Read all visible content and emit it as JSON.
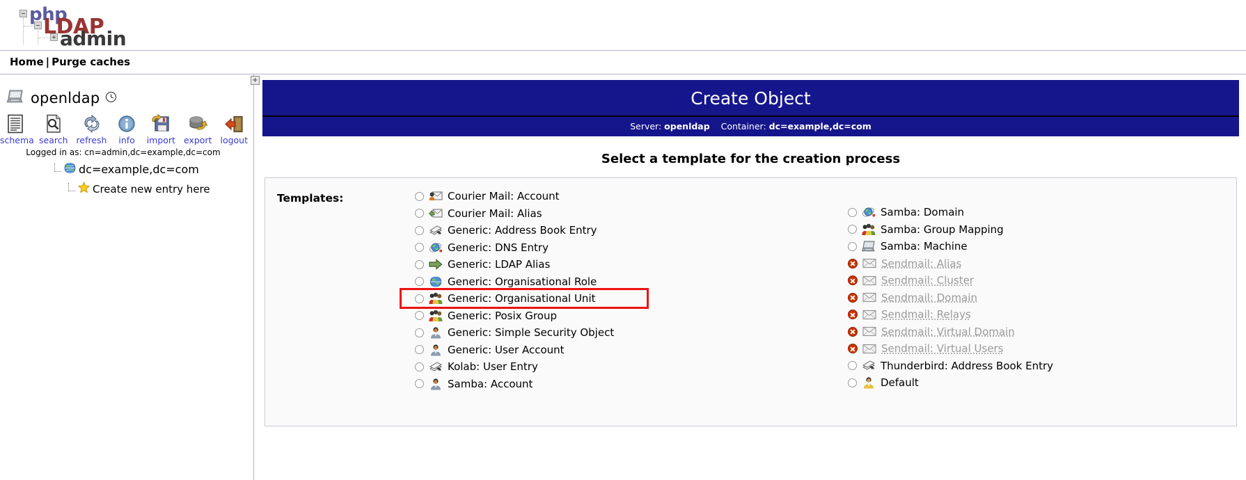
{
  "logo": {
    "part1": "php",
    "part2": "LDAP",
    "part3": "admin"
  },
  "navbar": {
    "home": "Home",
    "separator": "|",
    "purge": "Purge caches"
  },
  "sidebar": {
    "server_name": "openldap",
    "tools": [
      {
        "label": "schema",
        "icon": "schema-icon"
      },
      {
        "label": "search",
        "icon": "search-icon"
      },
      {
        "label": "refresh",
        "icon": "refresh-icon"
      },
      {
        "label": "info",
        "icon": "info-icon"
      },
      {
        "label": "import",
        "icon": "import-icon"
      },
      {
        "label": "export",
        "icon": "export-icon"
      },
      {
        "label": "logout",
        "icon": "logout-icon"
      }
    ],
    "logged_in_as": "Logged in as: cn=admin,dc=example,dc=com",
    "tree": [
      {
        "label": "dc=example,dc=com",
        "icon": "globe-icon"
      },
      {
        "label": "Create new entry here",
        "icon": "star-icon"
      }
    ],
    "expand_button": "+"
  },
  "header": {
    "title": "Create Object",
    "server_label": "Server:",
    "server_value": "openldap",
    "container_label": "Container:",
    "container_value": "dc=example,dc=com"
  },
  "main": {
    "section_title": "Select a template for the creation process",
    "templates_label": "Templates:",
    "left_column": [
      {
        "label": "Courier Mail: Account",
        "icon": "mail-user-icon",
        "disabled": false,
        "highlighted": false
      },
      {
        "label": "Courier Mail: Alias",
        "icon": "mail-arrow-icon",
        "disabled": false,
        "highlighted": false
      },
      {
        "label": "Generic: Address Book Entry",
        "icon": "address-book-icon",
        "disabled": false,
        "highlighted": false
      },
      {
        "label": "Generic: DNS Entry",
        "icon": "dns-globe-icon",
        "disabled": false,
        "highlighted": false
      },
      {
        "label": "Generic: LDAP Alias",
        "icon": "arrow-right-icon",
        "disabled": false,
        "highlighted": false
      },
      {
        "label": "Generic: Organisational Role",
        "icon": "globe-icon",
        "disabled": false,
        "highlighted": false
      },
      {
        "label": "Generic: Organisational Unit",
        "icon": "group-icon",
        "disabled": false,
        "highlighted": true
      },
      {
        "label": "Generic: Posix Group",
        "icon": "group-icon",
        "disabled": false,
        "highlighted": false
      },
      {
        "label": "Generic: Simple Security Object",
        "icon": "user-icon",
        "disabled": false,
        "highlighted": false
      },
      {
        "label": "Generic: User Account",
        "icon": "user-icon",
        "disabled": false,
        "highlighted": false
      },
      {
        "label": "Kolab: User Entry",
        "icon": "address-book-icon",
        "disabled": false,
        "highlighted": false
      },
      {
        "label": "Samba: Account",
        "icon": "user-icon",
        "disabled": false,
        "highlighted": false
      }
    ],
    "right_column": [
      {
        "label": "Samba: Domain",
        "icon": "dns-globe-icon",
        "disabled": false
      },
      {
        "label": "Samba: Group Mapping",
        "icon": "group-icon",
        "disabled": false
      },
      {
        "label": "Samba: Machine",
        "icon": "computer-icon",
        "disabled": false
      },
      {
        "label": "Sendmail: Alias",
        "icon": "envelope-icon",
        "disabled": true
      },
      {
        "label": "Sendmail: Cluster",
        "icon": "envelope-icon",
        "disabled": true
      },
      {
        "label": "Sendmail: Domain",
        "icon": "envelope-icon",
        "disabled": true
      },
      {
        "label": "Sendmail: Relays",
        "icon": "envelope-icon",
        "disabled": true
      },
      {
        "label": "Sendmail: Virtual Domain",
        "icon": "envelope-icon",
        "disabled": true
      },
      {
        "label": "Sendmail: Virtual Users",
        "icon": "envelope-icon",
        "disabled": true
      },
      {
        "label": "Thunderbird: Address Book Entry",
        "icon": "address-book-icon",
        "disabled": false
      },
      {
        "label": "Default",
        "icon": "user-color-icon",
        "disabled": false
      }
    ]
  },
  "colors": {
    "header_blue": "#16168c",
    "link_blue": "#3a3ad0",
    "highlight_red": "#ee1111",
    "disabled_gray": "#9a9a9a",
    "logo_php": "#5b5ba0",
    "logo_ldap": "#9a3434",
    "logo_admin": "#3a3a3a"
  }
}
